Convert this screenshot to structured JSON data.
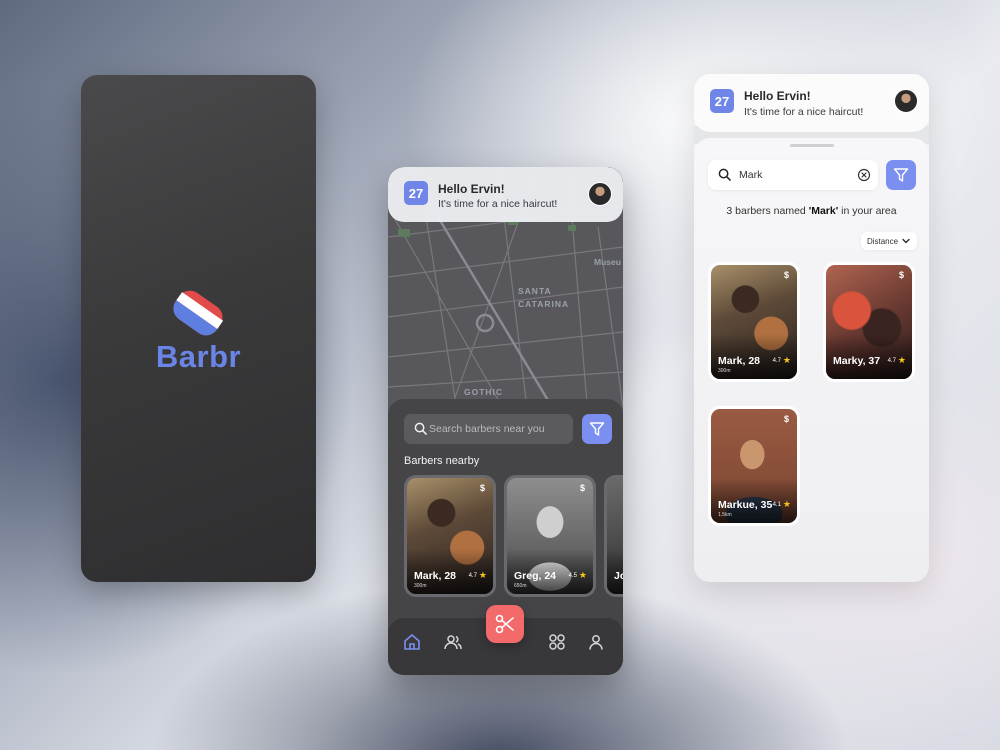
{
  "splash": {
    "brand": "Barbr"
  },
  "home": {
    "date_badge": "27",
    "greeting": "Hello Ervin!",
    "subtitle": "It's time for a nice haircut!",
    "map_labels": [
      "Museu",
      "SANTA CATARINA",
      "GOTHIC"
    ],
    "search_placeholder": "Search barbers near you",
    "section_title": "Barbers nearby",
    "barbers": [
      {
        "name": "Mark, 28",
        "price": "$",
        "distance": "300m",
        "rating": "4.7"
      },
      {
        "name": "Greg, 24",
        "price": "$",
        "distance": "650m",
        "rating": "4.5"
      },
      {
        "name": "Jo",
        "price": "",
        "distance": "",
        "rating": ""
      }
    ],
    "nav": [
      "home-icon",
      "users-icon",
      "scissors-icon",
      "grid-icon",
      "profile-icon"
    ]
  },
  "search": {
    "date_badge": "27",
    "greeting": "Hello Ervin!",
    "subtitle": "It's time for a nice haircut!",
    "query": "Mark",
    "results_prefix": "3 barbers named ",
    "results_name": "'Mark'",
    "results_suffix": " in your area",
    "sort_label": "Distance",
    "results": [
      {
        "name": "Mark, 28",
        "price": "$",
        "distance": "300m",
        "rating": "4.7"
      },
      {
        "name": "Marky, 37",
        "price": "$",
        "distance": "",
        "rating": "4.7"
      },
      {
        "name": "Markue, 35",
        "price": "$",
        "distance": "1.5km",
        "rating": "4.1"
      }
    ]
  },
  "colors": {
    "accent": "#6f86e8",
    "fab": "#f26a6a",
    "logo_red": "#e34b4b",
    "logo_blue": "#5f7fe0"
  }
}
